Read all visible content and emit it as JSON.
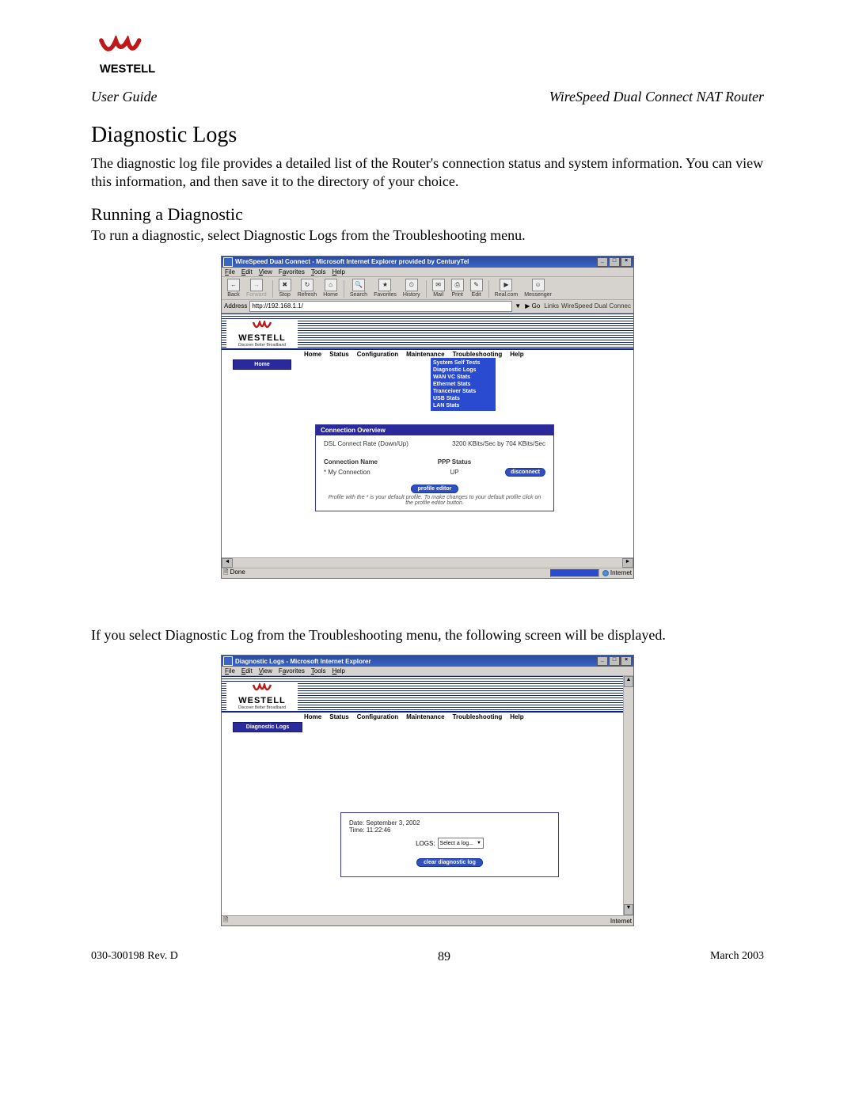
{
  "header": {
    "left": "User Guide",
    "right": "WireSpeed Dual Connect NAT Router"
  },
  "logo": {
    "brand": "WESTELL",
    "tagline": "Discover Better Broadband"
  },
  "section_title": "Diagnostic Logs",
  "intro_text": "The diagnostic log file provides a detailed list of the Router's connection status and system information. You can view this information, and then save it to the directory of your choice.",
  "sub_title": "Running a Diagnostic",
  "instr1": "To run a diagnostic, select Diagnostic Logs from the Troubleshooting menu.",
  "instr2": "If you select Diagnostic Log from the Troubleshooting menu, the following screen will be displayed.",
  "footer": {
    "docnum": "030-300198 Rev. D",
    "page": "89",
    "date": "March 2003"
  },
  "screenshot1": {
    "title": "WireSpeed Dual Connect - Microsoft Internet Explorer provided by CenturyTel",
    "menus": [
      "File",
      "Edit",
      "View",
      "Favorites",
      "Tools",
      "Help"
    ],
    "toolbar": [
      "Back",
      "Forward",
      "Stop",
      "Refresh",
      "Home",
      "Search",
      "Favorites",
      "History",
      "Mail",
      "Print",
      "Edit",
      "Real.com",
      "Messenger"
    ],
    "address_label": "Address",
    "address_value": "http://192.168.1.1/",
    "go": "Go",
    "links_label": "Links",
    "links_text": "WireSpeed Dual Connec",
    "nav": [
      "Home",
      "Status",
      "Configuration",
      "Maintenance",
      "Troubleshooting",
      "Help"
    ],
    "sidebar": "Home",
    "ts_menu": [
      "System Self Tests",
      "Diagnostic Logs",
      "WAN VC Stats",
      "Ethernet Stats",
      "Tranceiver Stats",
      "USB Stats",
      "LAN Stats"
    ],
    "panel_title": "Connection Overview",
    "rate_label": "DSL Connect Rate (Down/Up)",
    "rate_value": "3200 KBits/Sec by 704 KBits/Sec",
    "col1": "Connection Name",
    "col2": "PPP Status",
    "conn_name": "My Connection",
    "conn_status": "UP",
    "disconnect": "disconnect",
    "profile_editor": "profile editor",
    "note": "Profile with the * is your default profile. To make changes to your default profile click on the profile editor button.",
    "status_done": "Done",
    "status_zone": "Internet"
  },
  "screenshot2": {
    "title": "Diagnostic Logs - Microsoft Internet Explorer",
    "menus": [
      "File",
      "Edit",
      "View",
      "Favorites",
      "Tools",
      "Help"
    ],
    "nav": [
      "Home",
      "Status",
      "Configuration",
      "Maintenance",
      "Troubleshooting",
      "Help"
    ],
    "sidebar": "Diagnostic Logs",
    "date_label": "Date: September 3, 2002",
    "time_label": "Time: 11:22:46",
    "logs_label": "LOGS:",
    "select_value": "Select a log...",
    "clear_btn": "clear diagnostic log",
    "status_zone": "Internet"
  }
}
